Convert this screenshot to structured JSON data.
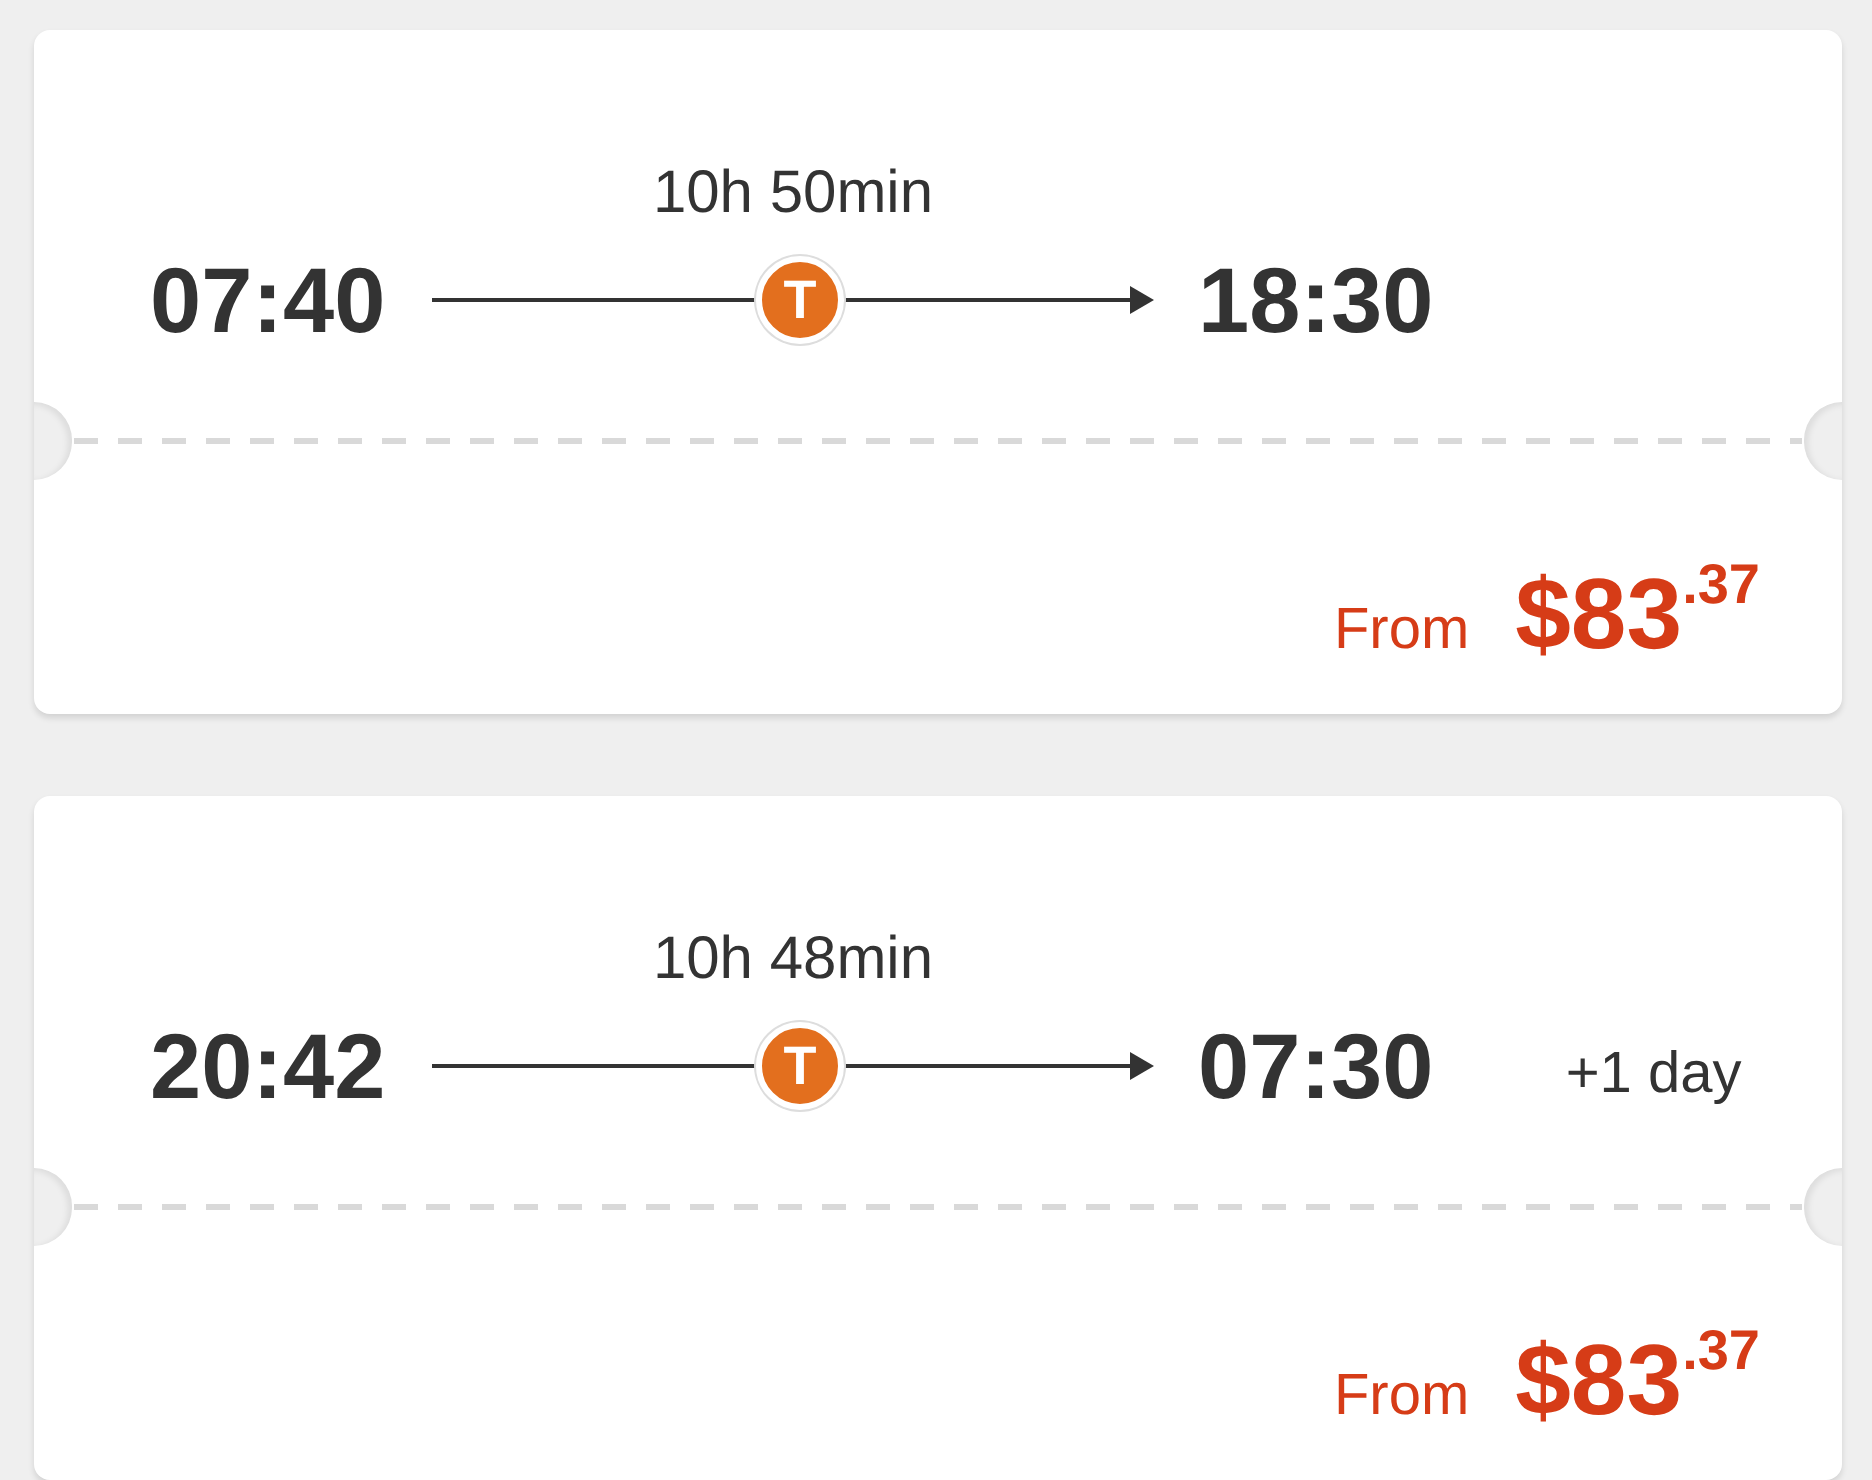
{
  "trips": [
    {
      "duration": "10h 50min",
      "departure": "07:40",
      "mode_badge": "T",
      "arrival": "18:30",
      "price_label": "From",
      "price": "$83$^{.37}$"
    },
    {
      "duration": "10h 48min",
      "departure": "20:42",
      "mode_badge": "T",
      "arrival": "07:30",
      "day_offset": "+1 day",
      "price_label": "From",
      "price": "$83$^{.37}$"
    }
  ]
}
